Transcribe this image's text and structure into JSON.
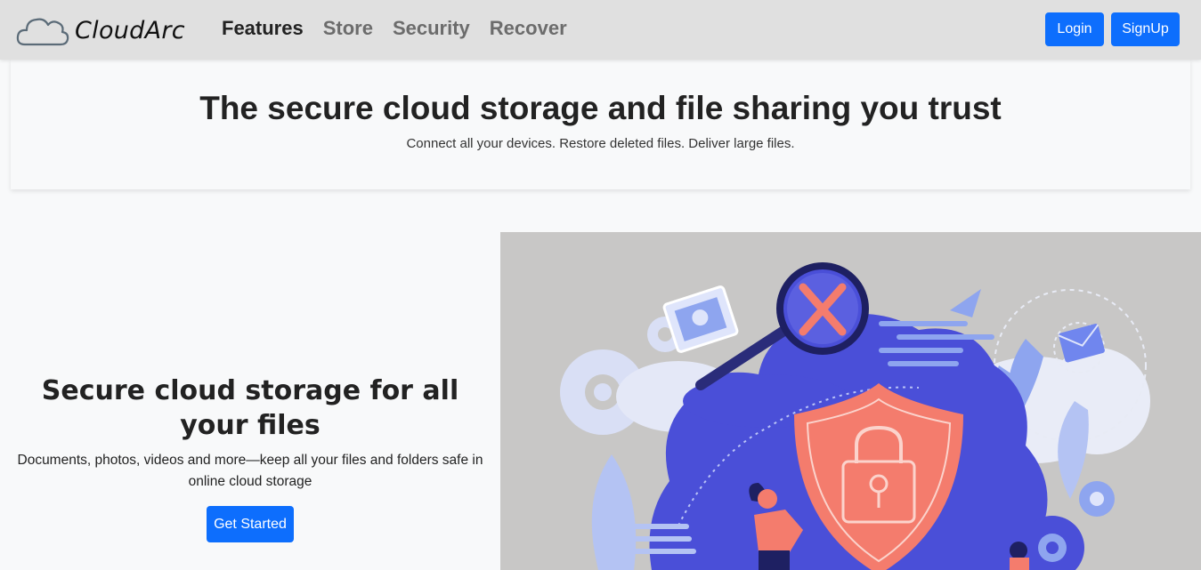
{
  "brand": {
    "name": "CloudArc",
    "logo_icon": "cloud-icon"
  },
  "nav": {
    "links": [
      {
        "label": "Features",
        "active": true
      },
      {
        "label": "Store",
        "active": false
      },
      {
        "label": "Security",
        "active": false
      },
      {
        "label": "Recover",
        "active": false
      }
    ],
    "login_label": "Login",
    "signup_label": "SignUp"
  },
  "hero": {
    "title": "The secure cloud storage and file sharing you trust",
    "subtitle": "Connect all your devices. Restore deleted files. Deliver large files."
  },
  "feature": {
    "title": "Secure cloud storage for all your files",
    "description": "Documents, photos, videos and more—keep all your files and folders safe in online cloud storage",
    "cta_label": "Get Started"
  },
  "illustration": {
    "icons": [
      "cloud-icon",
      "magnifier-icon",
      "shield-lock-icon",
      "image-icon",
      "envelope-icon",
      "paper-plane-icon",
      "gear-icon",
      "person-icon"
    ]
  },
  "colors": {
    "primary": "#0d6efd",
    "navbar_bg": "#e0e0e0",
    "page_bg": "#f8f9fa",
    "illustration_bg": "#c8c7c6",
    "illustration_blue": "#4a4fd8",
    "illustration_coral": "#f47c6d"
  }
}
